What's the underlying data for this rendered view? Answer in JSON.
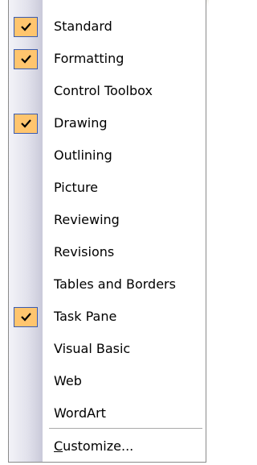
{
  "menu": {
    "items": [
      {
        "label": "Standard",
        "checked": true
      },
      {
        "label": "Formatting",
        "checked": true
      },
      {
        "label": "Control Toolbox",
        "checked": false
      },
      {
        "label": "Drawing",
        "checked": true
      },
      {
        "label": "Outlining",
        "checked": false
      },
      {
        "label": "Picture",
        "checked": false
      },
      {
        "label": "Reviewing",
        "checked": false
      },
      {
        "label": "Revisions",
        "checked": false
      },
      {
        "label": "Tables and Borders",
        "checked": false
      },
      {
        "label": "Task Pane",
        "checked": true
      },
      {
        "label": "Visual Basic",
        "checked": false
      },
      {
        "label": "Web",
        "checked": false
      },
      {
        "label": "WordArt",
        "checked": false
      }
    ],
    "customize": {
      "mnemonic": "C",
      "rest": "ustomize..."
    }
  },
  "colors": {
    "check_highlight": "#ffc56e",
    "check_border": "#3a5bb0"
  },
  "icons": {
    "checked": "checkmark-icon"
  }
}
